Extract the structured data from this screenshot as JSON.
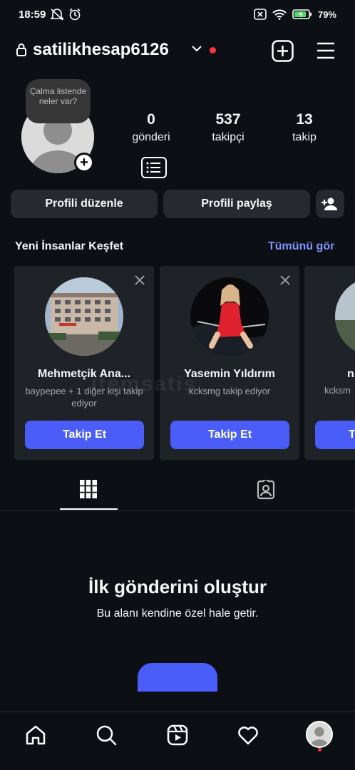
{
  "status_bar": {
    "time": "18:59",
    "battery": "79%"
  },
  "header": {
    "username": "satilikhesap6126"
  },
  "note": {
    "text": "Çalma listende neler var?"
  },
  "stats": [
    {
      "value": "0",
      "label": "gönderi"
    },
    {
      "value": "537",
      "label": "takipçi"
    },
    {
      "value": "13",
      "label": "takip"
    }
  ],
  "actions": {
    "edit_profile": "Profili düzenle",
    "share_profile": "Profili paylaş"
  },
  "discover": {
    "title": "Yeni İnsanlar Keşfet",
    "see_all": "Tümünü gör",
    "cards": [
      {
        "name": "Mehmetçik Ana...",
        "subtitle": "baypepee + 1 diğer kişi takip ediyor",
        "button": "Takip Et"
      },
      {
        "name": "Yasemin Yıldırım",
        "subtitle": "kcksmg takip ediyor",
        "button": "Takip Et"
      },
      {
        "name": "n",
        "subtitle": "kcksm",
        "button": "T"
      }
    ]
  },
  "empty_state": {
    "title": "İlk gönderini oluştur",
    "subtitle": "Bu alanı kendine özel hale getir."
  },
  "watermark": "itemsatis",
  "colors": {
    "background": "#0c1014",
    "accent": "#4a5df9",
    "link": "#7d95ff",
    "notification": "#ff3040"
  }
}
